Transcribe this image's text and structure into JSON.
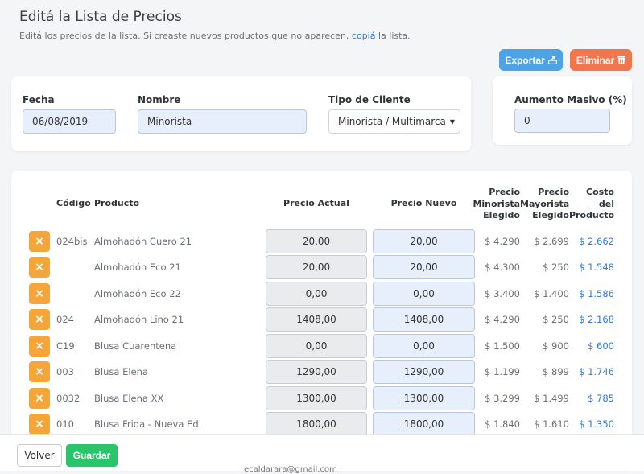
{
  "header": {
    "title": "Editá la Lista de Precios",
    "subtitle_before": "Editá los precios de la lista. Si creaste nuevos productos que no aparecen, ",
    "subtitle_link": "copiá",
    "subtitle_after": " la lista."
  },
  "actions": {
    "export_label": "Exportar",
    "delete_label": "Eliminar"
  },
  "form": {
    "fecha_label": "Fecha",
    "fecha_value": "06/08/2019",
    "nombre_label": "Nombre",
    "nombre_value": "Minorista",
    "tipo_label": "Tipo de Cliente",
    "tipo_value": "Minorista / Multimarca"
  },
  "aumento": {
    "label": "Aumento Masivo (%)",
    "value": "0"
  },
  "table": {
    "headers": {
      "codigo": "Código",
      "producto": "Producto",
      "actual": "Precio Actual",
      "nuevo": "Precio Nuevo",
      "minorista": [
        "Precio",
        "Minorista",
        "Elegido"
      ],
      "mayorista": [
        "Precio",
        "Mayorista",
        "Elegido"
      ],
      "costo": [
        "Costo",
        "del",
        "Producto"
      ]
    },
    "remove_symbol": "×",
    "rows": [
      {
        "codigo": "024bis",
        "producto": "Almohadón Cuero 21",
        "actual": "20,00",
        "nuevo": "20,00",
        "minorista": "$ 4.290",
        "mayorista": "$ 2.699",
        "costo": "$ 2.662"
      },
      {
        "codigo": "",
        "producto": "Almohadón Eco 21",
        "actual": "20,00",
        "nuevo": "20,00",
        "minorista": "$ 4.300",
        "mayorista": "$ 250",
        "costo": "$ 1.548"
      },
      {
        "codigo": "",
        "producto": "Almohadón Eco 22",
        "actual": "0,00",
        "nuevo": "0,00",
        "minorista": "$ 3.400",
        "mayorista": "$ 1.400",
        "costo": "$ 1.586"
      },
      {
        "codigo": "024",
        "producto": "Almohadón Lino 21",
        "actual": "1408,00",
        "nuevo": "1408,00",
        "minorista": "$ 4.290",
        "mayorista": "$ 250",
        "costo": "$ 2.168"
      },
      {
        "codigo": "C19",
        "producto": "Blusa Cuarentena",
        "actual": "0,00",
        "nuevo": "0,00",
        "minorista": "$ 1.500",
        "mayorista": "$ 900",
        "costo": "$ 600"
      },
      {
        "codigo": "003",
        "producto": "Blusa Elena",
        "actual": "1290,00",
        "nuevo": "1290,00",
        "minorista": "$ 1.199",
        "mayorista": "$ 899",
        "costo": "$ 1.746"
      },
      {
        "codigo": "0032",
        "producto": "Blusa Elena XX",
        "actual": "1300,00",
        "nuevo": "1300,00",
        "minorista": "$ 3.299",
        "mayorista": "$ 1.499",
        "costo": "$ 785"
      },
      {
        "codigo": "010",
        "producto": "Blusa Frida - Nueva Ed.",
        "actual": "1800,00",
        "nuevo": "1800,00",
        "minorista": "$ 1.840",
        "mayorista": "$ 1.610",
        "costo": "$ 1.350"
      }
    ]
  },
  "footer": {
    "volver_label": "Volver",
    "guardar_label": "Guardar",
    "email_partial": "ecaldarara@gmail.com"
  },
  "colors": {
    "export": "#4da3e6",
    "delete": "#f2764c",
    "remove_button": "#f5a53a",
    "guardar": "#29c56b",
    "link": "#2f7ad6"
  },
  "icons": {
    "export": "export-icon",
    "delete": "trash-icon",
    "dropdown": "caret-down-icon",
    "remove": "close-icon"
  }
}
